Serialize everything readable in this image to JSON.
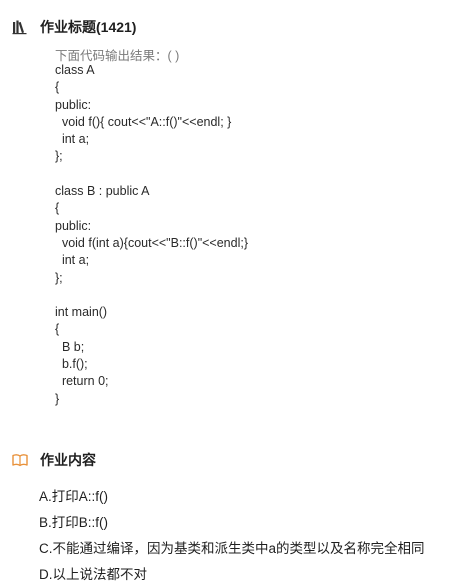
{
  "assignment_title": {
    "icon": "books-icon",
    "label": "作业标题(1421)"
  },
  "question": {
    "prompt": "下面代码输出结果：( )",
    "code_lines": [
      "class A",
      "{",
      "public:",
      "  void f(){ cout<<\"A::f()\"<<endl; }",
      "  int a;",
      "};",
      "",
      "class B : public A",
      "{",
      "public:",
      "  void f(int a){cout<<\"B::f()\"<<endl;}",
      "  int a;",
      "};",
      "",
      "int main()",
      "{",
      "  B b;",
      "  b.f();",
      "  return 0;",
      "}"
    ]
  },
  "assignment_content": {
    "icon": "open-book-icon",
    "label": "作业内容"
  },
  "options": [
    "A.打印A::f()",
    "B.打印B::f()",
    "C.不能通过编译，因为基类和派生类中a的类型以及名称完全相同",
    "D.以上说法都不对"
  ],
  "colors": {
    "icon_dark": "#333333",
    "icon_orange": "#e8913a",
    "prompt_gray": "#7a7a7a"
  }
}
